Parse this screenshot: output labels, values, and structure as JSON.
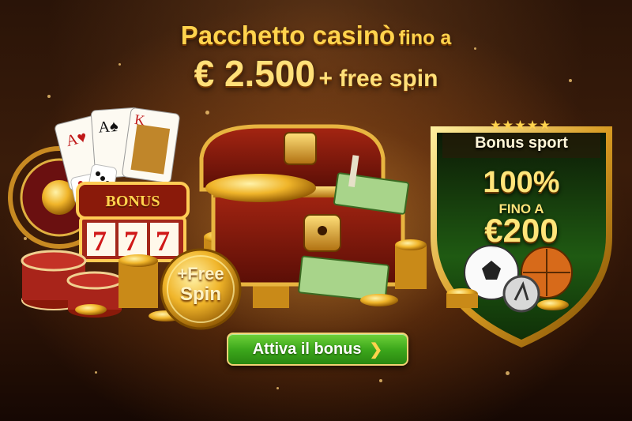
{
  "headline": {
    "line1_main": "Pacchetto casinò",
    "line1_suffix": "fino a",
    "line2_amount": "€ 2.500",
    "line2_suffix": "+ free spin"
  },
  "slot_machine": {
    "label": "BONUS",
    "reels": [
      "7",
      "7",
      "7"
    ]
  },
  "free_spin_badge": {
    "line1": "+Free",
    "line2": "Spin"
  },
  "sport_bonus": {
    "stars": "★★★★★",
    "title": "Bonus sport",
    "percent": "100%",
    "up_to": "FINO A",
    "amount": "€200"
  },
  "cta": {
    "label": "Attiva il bonus",
    "arrow": "❯"
  },
  "colors": {
    "gold": "#ffd34d",
    "cta_green": "#3da81c",
    "shield_green": "#1f5a12"
  }
}
